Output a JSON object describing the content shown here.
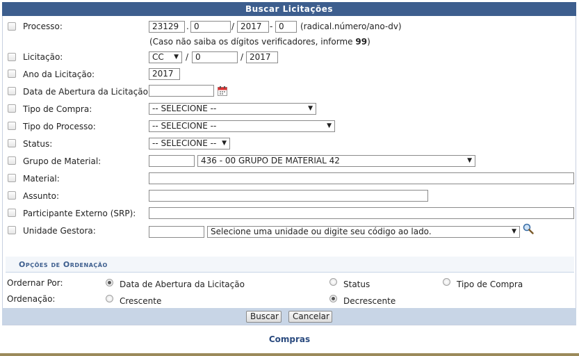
{
  "title": "Buscar Licitações",
  "fields": {
    "processo": {
      "label": "Processo:",
      "radical": "23129",
      "numero": "0",
      "ano": "2017",
      "dv": "0",
      "format_hint": "(radical.número/ano-dv)",
      "note_prefix": "(Caso não saiba os dígitos verificadores, informe ",
      "note_value": "99",
      "note_suffix": ")"
    },
    "licitacao": {
      "label": "Licitação:",
      "modalidade": "CC",
      "numero": "0",
      "ano": "2017"
    },
    "ano_licitacao": {
      "label": "Ano da Licitação:",
      "value": "2017"
    },
    "data_abertura": {
      "label": "Data de Abertura da Licitação:",
      "value": ""
    },
    "tipo_compra": {
      "label": "Tipo de Compra:",
      "selected": "-- SELECIONE --"
    },
    "tipo_processo": {
      "label": "Tipo do Processo:",
      "selected": "-- SELECIONE --"
    },
    "status": {
      "label": "Status:",
      "selected": "-- SELECIONE --"
    },
    "grupo_material": {
      "label": "Grupo de Material:",
      "code": "",
      "selected": "436 - 00 GRUPO DE MATERIAL 42"
    },
    "material": {
      "label": "Material:",
      "value": ""
    },
    "assunto": {
      "label": "Assunto:",
      "value": ""
    },
    "participante": {
      "label": "Participante Externo (SRP):",
      "value": ""
    },
    "unidade": {
      "label": "Unidade Gestora:",
      "code": "",
      "selected": "Selecione uma unidade ou digite seu código ao lado."
    }
  },
  "sort": {
    "section_title": "Opções de Ordenação",
    "order_by_label": "Ordernar Por:",
    "order_by_options": [
      "Data de Abertura da Licitação",
      "Status",
      "Tipo de Compra"
    ],
    "order_by_selected": "Data de Abertura da Licitação",
    "direction_label": "Ordenação:",
    "direction_options": [
      "Crescente",
      "Decrescente"
    ],
    "direction_selected": "Decrescente"
  },
  "buttons": {
    "search": "Buscar",
    "cancel": "Cancelar"
  },
  "footer_link": "Compras",
  "icons": {
    "calendar": "calendar-icon",
    "search": "magnifier-icon"
  },
  "colors": {
    "header": "#3d5e8e",
    "footer_bar": "#c8d5e6",
    "link": "#2b4b7f"
  }
}
